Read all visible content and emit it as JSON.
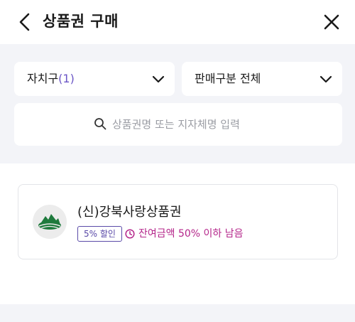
{
  "header": {
    "title": "상품권 구매",
    "back_icon": "chevron-left-icon",
    "close_icon": "close-icon"
  },
  "filters": {
    "district": {
      "label": "자치구",
      "count": "(1)"
    },
    "sale_type": {
      "label": "판매구분 전체"
    }
  },
  "search": {
    "placeholder": "상품권명 또는 지자체명 입력",
    "value": ""
  },
  "vouchers": [
    {
      "name": "(신)강북사랑상품권",
      "discount_badge": "5% 할인",
      "status": "잔여금액 50% 이하 남음",
      "logo_icon": "mountain-logo-icon"
    }
  ],
  "colors": {
    "accent_purple": "#5a4aa8",
    "status_magenta": "#b4258a",
    "logo_green": "#1e7a3c",
    "panel_bg": "#f3f4f8"
  }
}
